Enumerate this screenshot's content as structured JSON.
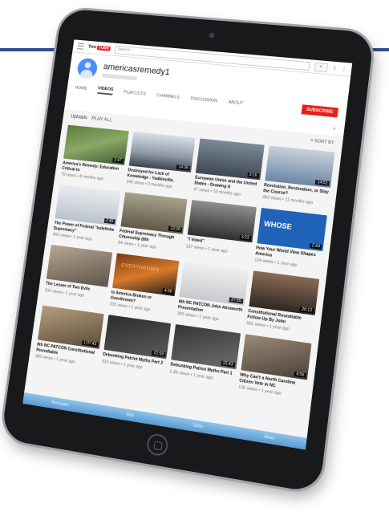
{
  "topbar": {
    "logo_text": "You",
    "logo_tube": "Tube",
    "search_placeholder": "Search",
    "search_icon": "search-icon"
  },
  "channel": {
    "name": "americasremedy1",
    "subscribe_label": "SUBSCRIBE"
  },
  "tabs": [
    {
      "label": "HOME",
      "active": false
    },
    {
      "label": "VIDEOS",
      "active": true
    },
    {
      "label": "PLAYLISTS",
      "active": false
    },
    {
      "label": "CHANNELS",
      "active": false
    },
    {
      "label": "DISCUSSION",
      "active": false
    },
    {
      "label": "ABOUT",
      "active": false
    }
  ],
  "uploads": {
    "label": "Uploads",
    "play_all": "PLAY ALL",
    "sort_label": "SORT BY"
  },
  "videos": [
    {
      "title": "America's Remedy: Education Critical to",
      "meta": "79 views • 8 months ago",
      "duration": "2:47"
    },
    {
      "title": "Destroyed for Lack of Knowledge - Yadkinville,",
      "meta": "346 views • 9 months ago",
      "duration": "14:36"
    },
    {
      "title": "European Union and the United States - Drawing A",
      "meta": "47 views • 10 months ago",
      "duration": "3:16"
    },
    {
      "title": "Revolution, Restoration, or Stay the Course?",
      "meta": "483 views • 11 months ago",
      "duration": "14:51"
    },
    {
      "title": "The Power of Federal \"Indefinite Supremacy\"",
      "meta": "369 views • 1 year ago",
      "duration": "2:46"
    },
    {
      "title": "Federal Supremacy Through Citizenship (8th",
      "meta": "84 views • 1 year ago",
      "duration": "13:26"
    },
    {
      "title": "\"I Voted\"",
      "meta": "137 views • 1 year ago",
      "duration": "3:23"
    },
    {
      "title": "How Your World View Shapes America",
      "meta": "124 views • 1 year ago",
      "duration": "2:44",
      "thumb_text": "WHOSE"
    },
    {
      "title": "The Lesser of Two Evils",
      "meta": "205 views • 1 year ago",
      "duration": ""
    },
    {
      "title": "Is America Broken or Overthrown?",
      "meta": "235 views • 1 year ago",
      "duration": "4:58",
      "thumb_text": "OVERTHROWN"
    },
    {
      "title": "8th NC PATCON John Ainsworth Presentation",
      "meta": "365 views • 1 year ago",
      "duration": "37:55"
    },
    {
      "title": "Constitutional Roundtable Follow Up By John",
      "meta": "582 views • 1 year ago",
      "duration": "26:12"
    },
    {
      "title": "8th NC PATCON Constitutional Roundtable",
      "meta": "480 views • 1 year ago",
      "duration": "1:07:43"
    },
    {
      "title": "Debunking Patriot Myths Part 2",
      "meta": "516 views • 1 year ago",
      "duration": "21:59"
    },
    {
      "title": "Debunking Patriot Myths Part 1",
      "meta": "1.3K views • 1 year ago",
      "duration": "22:43"
    },
    {
      "title": "Why Can't a North Carolina Citizen Vote in NC",
      "meta": "136 views • 1 year ago",
      "duration": "4:56"
    }
  ],
  "dock": [
    "Messages",
    "Mail",
    "Safari",
    "Music"
  ]
}
